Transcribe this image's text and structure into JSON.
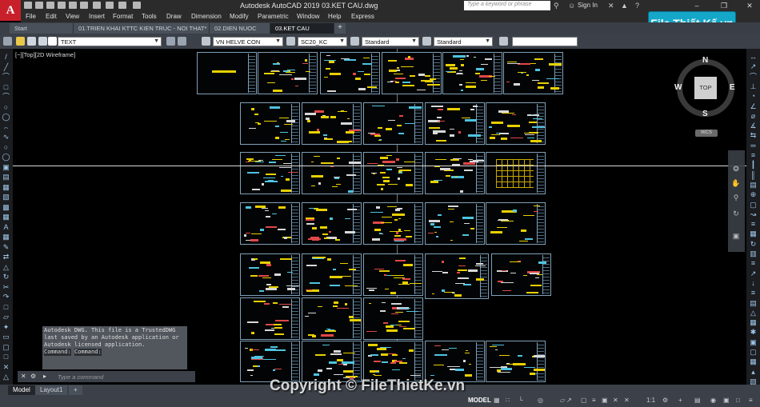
{
  "window": {
    "title": "Autodesk AutoCAD 2019   03.KET CAU.dwg",
    "search_placeholder": "Type a keyword or phrase",
    "sign_in": "Sign In",
    "app_letter": "A"
  },
  "menu": [
    "File",
    "Edit",
    "View",
    "Insert",
    "Format",
    "Tools",
    "Draw",
    "Dimension",
    "Modify",
    "Parametric",
    "Window",
    "Help",
    "Express"
  ],
  "tabs": [
    {
      "label": "Start"
    },
    {
      "label": "01.TRIEN KHAI KTTC KIEN TRUC - NOI THAT*"
    },
    {
      "label": "02.DIEN NUOC"
    },
    {
      "label": "03.KET CAU"
    }
  ],
  "properties": {
    "layer": "TEXT",
    "text_style": "VN HELVE CON",
    "dim_style": "SC20_KC",
    "table_style": "Standard",
    "multileader_style": "Standard"
  },
  "viewport": {
    "label": "[−][Top][2D Wireframe]"
  },
  "viewcube": {
    "top": "TOP",
    "north": "N",
    "south": "S",
    "east": "E",
    "west": "W",
    "wcs": "WCS"
  },
  "command": {
    "history": [
      "Autodesk DWG.  This file is a TrustedDWG",
      "last saved by an Autodesk application or",
      "Autodesk licensed application.",
      "Command:",
      "Command:"
    ],
    "placeholder": "Type a command"
  },
  "layout_tabs": [
    {
      "label": "Model"
    },
    {
      "label": "Layout1"
    }
  ],
  "status": {
    "model": "MODEL",
    "scale": "1:1"
  },
  "watermark": {
    "copyright": "Copyright © FileThietKe.vn",
    "logo": "File Thiết Kế.vn"
  },
  "colors": {
    "accent": "#c8202a",
    "sheet_border": "#7fa0b8",
    "drawing_yellow": "#e8d000",
    "background": "#000000"
  }
}
